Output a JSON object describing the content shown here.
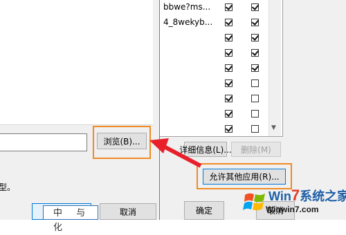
{
  "app_list": {
    "rows": [
      {
        "name": "bbwe?ms...",
        "col1": true,
        "col2": true
      },
      {
        "name": "4_8wekyb...",
        "col1": true,
        "col2": true
      },
      {
        "name": "",
        "col1": true,
        "col2": true
      },
      {
        "name": "",
        "col1": true,
        "col2": true
      },
      {
        "name": "",
        "col1": true,
        "col2": true
      },
      {
        "name": "",
        "col1": true,
        "col2": false
      },
      {
        "name": "",
        "col1": true,
        "col2": false
      },
      {
        "name": "",
        "col1": true,
        "col2": false
      },
      {
        "name": "",
        "col1": true,
        "col2": false
      }
    ]
  },
  "back_buttons": {
    "details": "详细信息(L)...",
    "remove": "删除(M)",
    "allow_other": "允许其他应用(R)...",
    "ok": "确定",
    "cancel": "取消"
  },
  "front_dialog": {
    "browse": "浏览(B)...",
    "truncated_text": "型。",
    "logo_text": "中 与 化",
    "cancel": "取消"
  },
  "watermark": {
    "title_prefix": "Win",
    "title_seven": "7",
    "title_suffix": "系统之家",
    "url": "Winwin7.com"
  },
  "colors": {
    "highlight": "#f08a24",
    "arrow": "#e8202a",
    "focus": "#0078d7"
  }
}
